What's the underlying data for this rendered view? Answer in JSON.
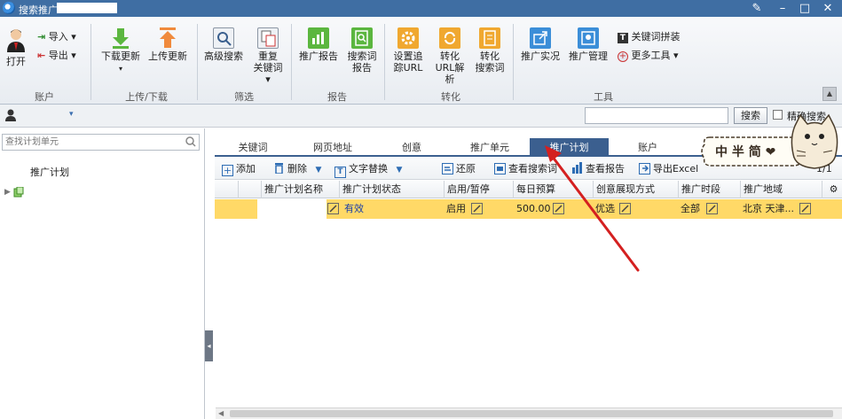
{
  "titlebar": {
    "title": "搜索推广-",
    "controls": [
      "edit",
      "minimize",
      "maximize",
      "close"
    ]
  },
  "ribbon": {
    "account": {
      "open": "打开",
      "import": "导入",
      "export": "导出",
      "group": "账户"
    },
    "transfer": {
      "download": "下载更新",
      "upload": "上传更新",
      "group": "上传/下载"
    },
    "filter": {
      "advanced_search": "高级搜索",
      "dup_keyword_l1": "重复",
      "dup_keyword_l2": "关键词",
      "group": "筛选"
    },
    "report": {
      "promo_report": "推广报告",
      "search_l1": "搜索词",
      "search_l2": "报告",
      "group": "报告"
    },
    "convert": {
      "tracking_l1": "设置追",
      "tracking_l2": "踪URL",
      "url_l1": "转化",
      "url_l2": "URL解析",
      "sw_l1": "转化",
      "sw_l2": "搜索词",
      "group": "转化"
    },
    "tools": {
      "live": "推广实况",
      "manage": "推广管理",
      "keyword_combine": "关键词拼装",
      "more_tools": "更多工具",
      "group": "工具"
    }
  },
  "secondbar": {
    "search_button": "搜索",
    "precise_label": "精确搜索"
  },
  "sidebar": {
    "search_placeholder": "查找计划单元",
    "header": "推广计划"
  },
  "tabs": [
    "关键词",
    "网页地址",
    "创意",
    "推广单元",
    "推广计划",
    "账户"
  ],
  "active_tab": "推广计划",
  "toolbar": {
    "add": "添加",
    "delete": "删除",
    "replace": "文字替换",
    "restore": "还原",
    "view_search": "查看搜索词",
    "view_report": "查看报告",
    "export": "导出Excel",
    "page": "1/1"
  },
  "grid": {
    "headers": [
      "推广计划名称",
      "推广计划状态",
      "启用/暂停",
      "每日预算",
      "创意展现方式",
      "推广时段",
      "推广地域"
    ],
    "row": {
      "name": "",
      "status": "有效",
      "enabled": "启用",
      "budget": "500.00",
      "display": "优选",
      "time": "全部",
      "region": "北京 天津..."
    }
  },
  "sticker_text": "中 半 简 ❤",
  "colors": {
    "titlebar": "#3f6ea3",
    "active_tab": "#3b5f8f",
    "selected_row": "#ffd967",
    "arrow": "#d42020",
    "status_text": "#1a3fa8"
  }
}
